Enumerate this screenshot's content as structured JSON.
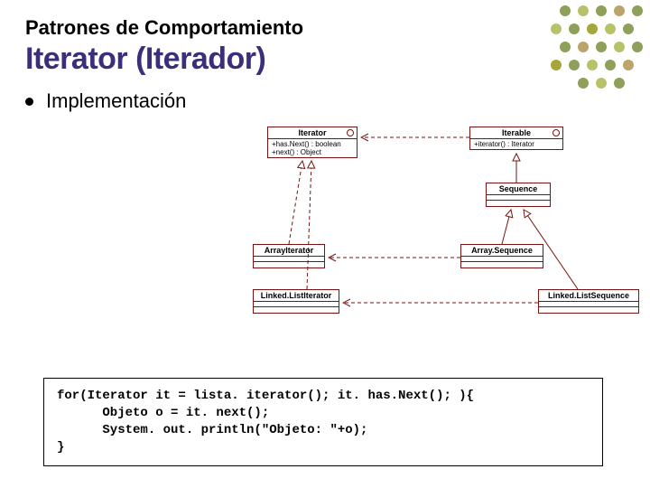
{
  "supertitle": "Patrones de Comportamiento",
  "title": "Iterator (Iterador)",
  "bullet": "Implementación",
  "uml": {
    "iterator": {
      "name": "Iterator",
      "ops": "+has.Next() : boolean\n+next() : Object"
    },
    "iterable": {
      "name": "Iterable",
      "ops": "+iterator() : Iterator"
    },
    "sequence": {
      "name": "Sequence"
    },
    "arrayIterator": {
      "name": "ArrayIterator"
    },
    "linkedListIterator": {
      "name": "Linked.ListIterator"
    },
    "arraySequence": {
      "name": "Array.Sequence"
    },
    "linkedListSequence": {
      "name": "Linked.ListSequence"
    }
  },
  "code": "for(Iterator it = lista. iterator(); it. has.Next(); ){\n      Objeto o = it. next();\n      System. out. println(\"Objeto: \"+o);\n}",
  "chart_data": {
    "type": "table",
    "description": "UML class diagram for Iterator pattern",
    "classes": [
      {
        "name": "Iterator",
        "stereotype": "interface",
        "operations": [
          "+hasNext() : boolean",
          "+next() : Object"
        ]
      },
      {
        "name": "Iterable",
        "stereotype": "interface",
        "operations": [
          "+iterator() : Iterator"
        ]
      },
      {
        "name": "Sequence",
        "extends": "Iterable"
      },
      {
        "name": "ArrayIterator",
        "implements": [
          "Iterator"
        ]
      },
      {
        "name": "LinkedListIterator",
        "implements": [
          "Iterator"
        ]
      },
      {
        "name": "ArraySequence",
        "extends": "Sequence",
        "uses": [
          "ArrayIterator"
        ]
      },
      {
        "name": "LinkedListSequence",
        "extends": "Sequence",
        "uses": [
          "LinkedListIterator"
        ]
      }
    ],
    "relationships": [
      {
        "from": "Iterable",
        "to": "Iterator",
        "type": "dependency/creates"
      },
      {
        "from": "Sequence",
        "to": "Iterable",
        "type": "generalization"
      },
      {
        "from": "ArrayIterator",
        "to": "Iterator",
        "type": "realization"
      },
      {
        "from": "LinkedListIterator",
        "to": "Iterator",
        "type": "realization"
      },
      {
        "from": "ArraySequence",
        "to": "Sequence",
        "type": "generalization"
      },
      {
        "from": "LinkedListSequence",
        "to": "Sequence",
        "type": "generalization"
      },
      {
        "from": "ArraySequence",
        "to": "ArrayIterator",
        "type": "dependency/creates"
      },
      {
        "from": "LinkedListSequence",
        "to": "LinkedListIterator",
        "type": "dependency/creates"
      }
    ]
  }
}
